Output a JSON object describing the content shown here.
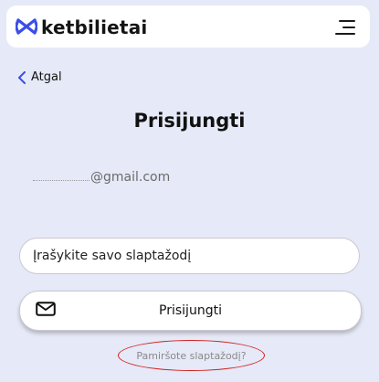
{
  "header": {
    "brand": "ketbilietai",
    "brand_color": "#3a4ee8",
    "logo_icon": "ketbilietai-logo-icon",
    "menu_icon": "hamburger-menu-icon"
  },
  "nav": {
    "back_label": "Atgal",
    "back_icon": "chevron-left-icon"
  },
  "page": {
    "title": "Prisijungti"
  },
  "form": {
    "email_suffix": "@gmail.com",
    "password_placeholder": "Įrašykite savo slaptažodį",
    "login_button_label": "Prisijungti",
    "login_button_icon": "mail-icon",
    "forgot_password": "Pamiršote slaptažodį?",
    "highlight_color": "#d32020"
  }
}
